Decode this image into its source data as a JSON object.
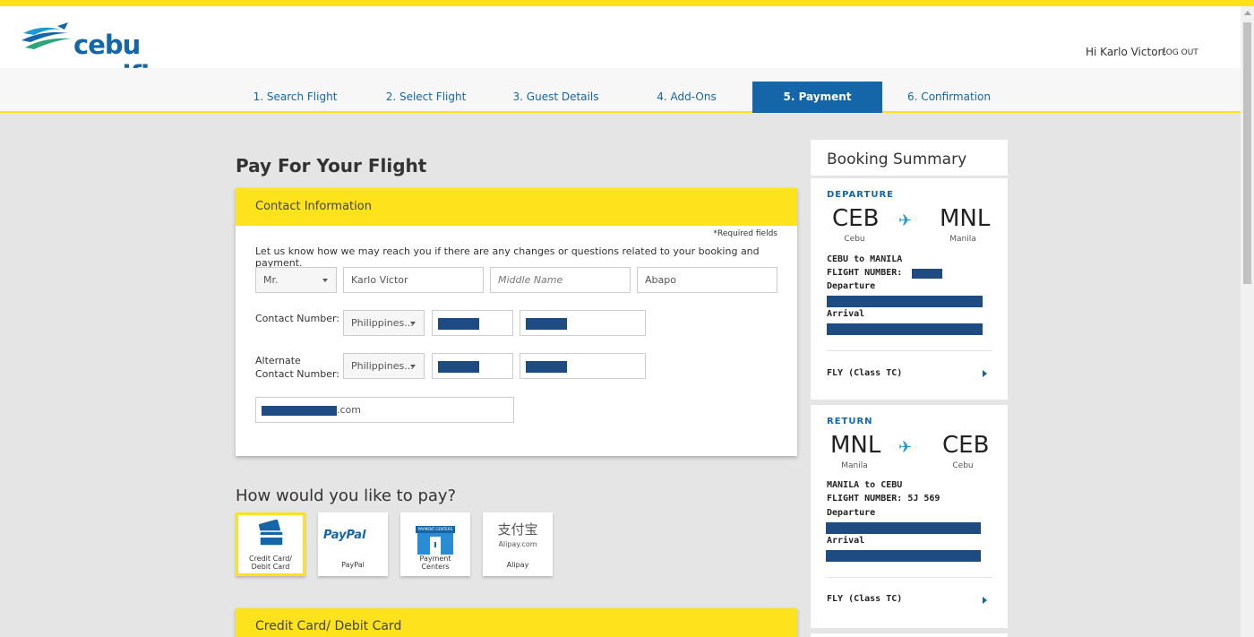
{
  "brand": {
    "name": "cebu pacific"
  },
  "user": {
    "greeting": "Hi Karlo Victor!",
    "logout": "LOG OUT"
  },
  "steps": [
    {
      "label": "1. Search Flight"
    },
    {
      "label": "2. Select Flight"
    },
    {
      "label": "3. Guest Details"
    },
    {
      "label": "4. Add-Ons"
    },
    {
      "label": "5. Payment",
      "active": true
    },
    {
      "label": "6. Confirmation"
    }
  ],
  "page": {
    "title": "Pay For Your Flight"
  },
  "contact": {
    "header": "Contact Information",
    "required_note": "*Required fields",
    "helper": "Let us know how we may reach you if there are any changes or questions related to your booking and payment.",
    "title_value": "Mr.",
    "first_name": "Karlo Victor",
    "middle_name_placeholder": "Middle Name",
    "last_name": "Abapo",
    "contact_label": "Contact Number:",
    "contact_country": "Philippines...",
    "alternate_label_line1": "Alternate",
    "alternate_label_line2": "Contact Number:",
    "alternate_country": "Philippines...",
    "email_suffix": ".com"
  },
  "payment": {
    "title": "How would you like to pay?",
    "options": [
      {
        "label_line1": "Credit Card/",
        "label_line2": "Debit Card",
        "icon": "credit-card-icon",
        "selected": true
      },
      {
        "label_line1": "PayPal",
        "label_line2": "",
        "icon": "paypal-logo"
      },
      {
        "label_line1": "Payment",
        "label_line2": "Centers",
        "icon": "payment-centers-icon"
      },
      {
        "label_line1": "Alipay",
        "label_line2": "",
        "icon": "alipay-logo"
      }
    ],
    "paypal_logo_text": "PayPal",
    "alipay_logo_text": "支付宝",
    "alipay_domain": "Alipay.com",
    "payment_centers_sign": "PAYMENT CENTERS",
    "card_section_header": "Credit Card/ Debit Card"
  },
  "summary": {
    "title": "Booking Summary",
    "departure": {
      "label": "DEPARTURE",
      "from_code": "CEB",
      "from_city": "Cebu",
      "to_code": "MNL",
      "to_city": "Manila",
      "route": "CEBU to MANILA",
      "flight_number_label": "FLIGHT NUMBER:",
      "departure_label": "Departure",
      "arrival_label": "Arrival",
      "fare": "FLY (Class TC)"
    },
    "return": {
      "label": "RETURN",
      "from_code": "MNL",
      "from_city": "Manila",
      "to_code": "CEB",
      "to_city": "Cebu",
      "route": "MANILA to CEBU",
      "flight_number_label": "FLIGHT NUMBER:",
      "flight_number": "5J 569",
      "departure_label": "Departure",
      "arrival_label": "Arrival",
      "fare": "FLY (Class TC)"
    }
  },
  "colors": {
    "brand_blue": "#1466a8",
    "accent_yellow": "#fde21c",
    "redaction": "#1d4b82"
  }
}
